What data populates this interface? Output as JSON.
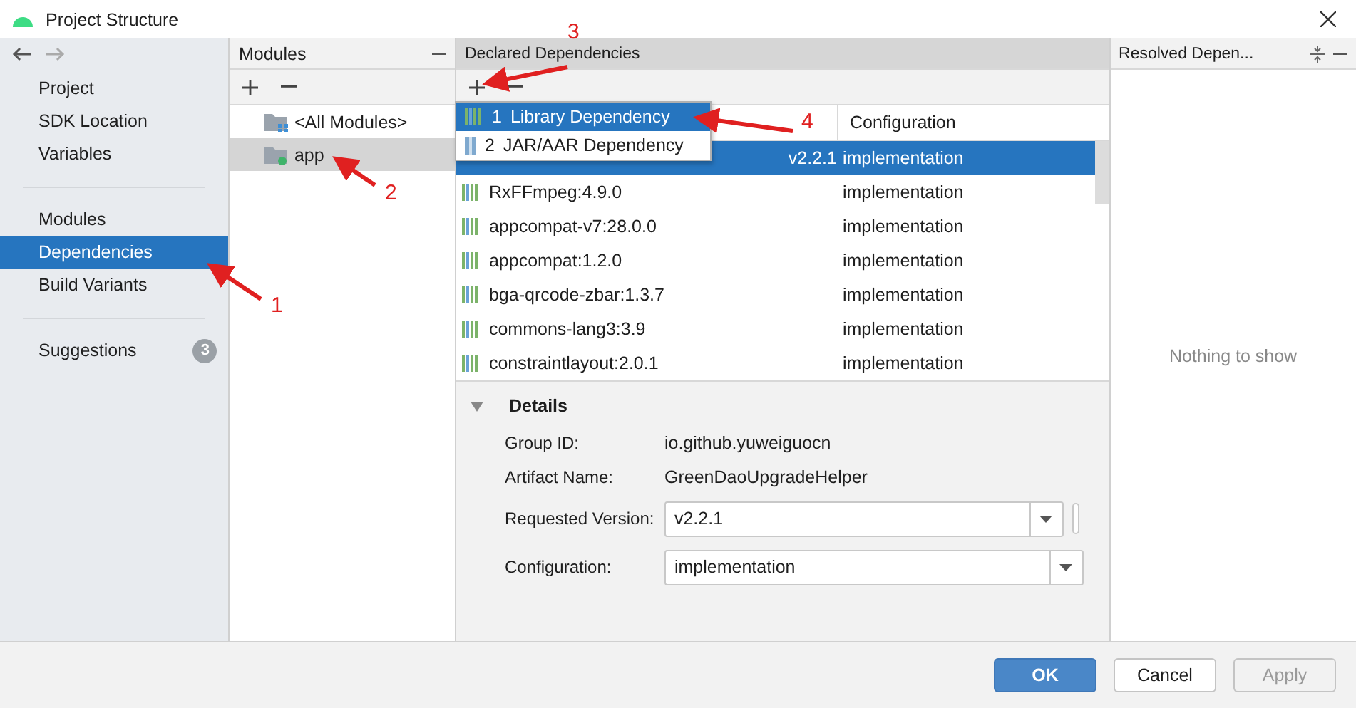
{
  "window": {
    "title": "Project Structure"
  },
  "nav": {
    "groups": [
      {
        "items": [
          {
            "label": "Project",
            "selected": false
          },
          {
            "label": "SDK Location",
            "selected": false
          },
          {
            "label": "Variables",
            "selected": false
          }
        ]
      },
      {
        "items": [
          {
            "label": "Modules",
            "selected": false
          },
          {
            "label": "Dependencies",
            "selected": true
          },
          {
            "label": "Build Variants",
            "selected": false
          }
        ]
      }
    ],
    "suggestions": {
      "label": "Suggestions",
      "badge": "3"
    }
  },
  "modules": {
    "title": "Modules",
    "items": [
      {
        "label": "<All Modules>",
        "kind": "all",
        "selected": false
      },
      {
        "label": "app",
        "kind": "module",
        "selected": true
      }
    ]
  },
  "declared": {
    "title": "Declared Dependencies",
    "menu": [
      {
        "number": "1",
        "label": "Library Dependency",
        "selected": true
      },
      {
        "number": "2",
        "label": "JAR/AAR Dependency",
        "selected": false
      }
    ],
    "configuration_header": "Configuration",
    "rows": [
      {
        "name": "v2.2.1",
        "configuration": "implementation",
        "selected": true
      },
      {
        "name": "RxFFmpeg:4.9.0",
        "configuration": "implementation",
        "selected": false
      },
      {
        "name": "appcompat-v7:28.0.0",
        "configuration": "implementation",
        "selected": false
      },
      {
        "name": "appcompat:1.2.0",
        "configuration": "implementation",
        "selected": false
      },
      {
        "name": "bga-qrcode-zbar:1.3.7",
        "configuration": "implementation",
        "selected": false
      },
      {
        "name": "commons-lang3:3.9",
        "configuration": "implementation",
        "selected": false
      },
      {
        "name": "constraintlayout:2.0.1",
        "configuration": "implementation",
        "selected": false
      }
    ]
  },
  "details": {
    "title": "Details",
    "expanded": true,
    "fields": [
      {
        "label": "Group ID:",
        "value": "io.github.yuweiguocn",
        "kind": "text"
      },
      {
        "label": "Artifact Name:",
        "value": "GreenDaoUpgradeHelper",
        "kind": "text"
      },
      {
        "label": "Requested Version:",
        "value": "v2.2.1",
        "kind": "combo"
      },
      {
        "label": "Configuration:",
        "value": "implementation",
        "kind": "combo"
      }
    ]
  },
  "resolved": {
    "title": "Resolved Depen...",
    "empty_text": "Nothing to show"
  },
  "buttons": [
    {
      "label": "OK",
      "kind": "primary"
    },
    {
      "label": "Cancel",
      "kind": "normal"
    },
    {
      "label": "Apply",
      "kind": "disabled"
    }
  ],
  "annotations": [
    {
      "label": "1"
    },
    {
      "label": "2"
    },
    {
      "label": "3"
    },
    {
      "label": "4"
    }
  ]
}
